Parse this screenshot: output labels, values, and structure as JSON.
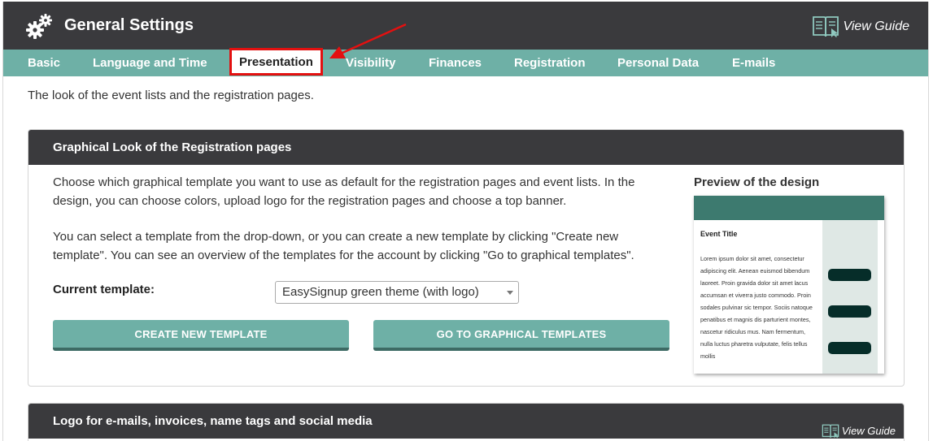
{
  "header": {
    "title": "General Settings",
    "guide_label": "View Guide"
  },
  "tabs": [
    {
      "label": "Basic"
    },
    {
      "label": "Language and Time"
    },
    {
      "label": "Presentation",
      "active": true
    },
    {
      "label": "Visibility"
    },
    {
      "label": "Finances"
    },
    {
      "label": "Registration"
    },
    {
      "label": "Personal Data"
    },
    {
      "label": "E-mails"
    }
  ],
  "intro": "The look of the event lists and the registration pages.",
  "graphical_panel": {
    "title": "Graphical Look of the Registration pages",
    "paragraph1": "Choose which graphical template you want to use as default for the registration pages and event lists. In the design, you can choose colors, upload logo for the registration pages and choose a top banner.",
    "paragraph2": "You can select a template from the drop-down, or you can create a new template by clicking \"Create new template\". You can see an overview of the templates for the account by clicking \"Go to graphical templates\".",
    "current_template_label": "Current template:",
    "current_template_value": "EasySignup green theme (with logo)",
    "create_button": "CREATE NEW TEMPLATE",
    "goto_button": "GO TO GRAPHICAL TEMPLATES",
    "preview_title": "Preview of the design",
    "preview": {
      "event_title": "Event Title",
      "lorem": "Lorem ipsum dolor sit amet, consectetur adipiscing elit. Aenean euismod bibendum laoreet. Proin gravida dolor sit amet lacus accumsan et viverra justo commodo. Proin sodales pulvinar sic tempor. Sociis natoque penatibus et magnis dis parturient montes, nascetur ridiculus mus. Nam fermentum, nulla luctus pharetra vulputate, felis tellus mollis"
    }
  },
  "logo_panel": {
    "title": "Logo for e-mails, invoices, name tags and social media",
    "guide_label": "View Guide"
  },
  "colors": {
    "header_bg": "#3a3a3d",
    "tab_bg": "#6eb0a6",
    "highlight": "#e31010",
    "preview_header": "#3d7a6f",
    "preview_pill": "#062d29"
  }
}
